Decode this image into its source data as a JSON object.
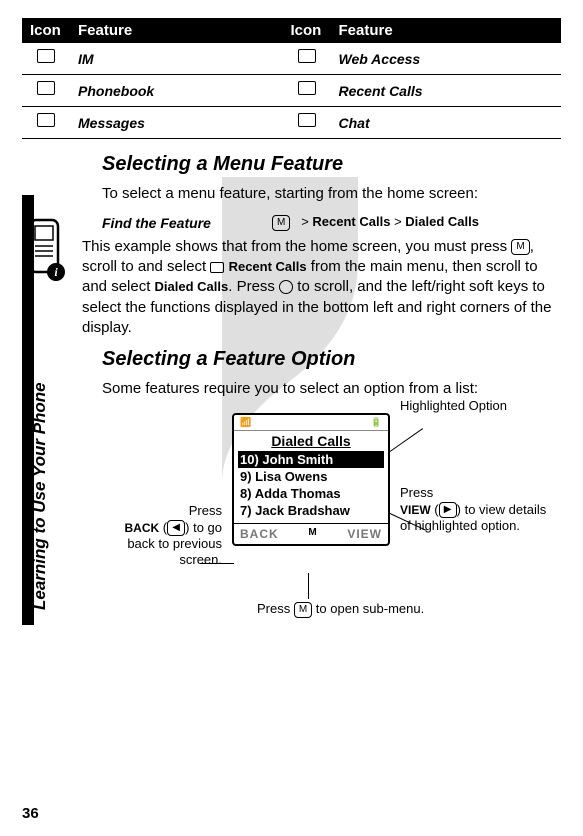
{
  "table": {
    "headers": [
      "Icon",
      "Feature",
      "Icon",
      "Feature"
    ],
    "rows": [
      {
        "a_label": "IM",
        "b_label": "Web Access"
      },
      {
        "a_label": "Phonebook",
        "b_label": "Recent Calls"
      },
      {
        "a_label": "Messages",
        "b_label": "Chat"
      }
    ]
  },
  "section1": {
    "heading": "Selecting a Menu Feature",
    "intro": "To select a menu feature, starting from the home screen:",
    "find_label": "Find the Feature",
    "path_sep": ">",
    "path_a": "Recent Calls",
    "path_b": "Dialed Calls",
    "menu_key": "M",
    "body_pre": "This example shows that from the home screen, you must press ",
    "body_mid1": ", scroll to and select ",
    "recent_calls_inline": "Recent Calls",
    "body_mid2": " from the main menu, then scroll to and select ",
    "dialed_calls_inline": "Dialed Calls",
    "body_mid3": ". Press ",
    "body_tail": " to scroll, and the left/right soft keys to select the functions displayed in the bottom left and right corners of the display."
  },
  "section2": {
    "heading": "Selecting a Feature Option",
    "intro": "Some features require you to select an option from a list:"
  },
  "phone_screen": {
    "title": "Dialed Calls",
    "items": [
      {
        "text": "10) John Smith",
        "highlighted": true
      },
      {
        "text": "9)  Lisa Owens",
        "highlighted": false
      },
      {
        "text": "8)  Adda Thomas",
        "highlighted": false
      },
      {
        "text": "7) Jack Bradshaw",
        "highlighted": false
      }
    ],
    "soft_left": "BACK",
    "soft_right": "VIEW",
    "soft_mid": "M"
  },
  "callouts": {
    "highlighted": "Highlighted Option",
    "view_pre": "Press ",
    "view_label": "VIEW",
    "view_post": " to view details of highlighted option.",
    "back_pre": "Press",
    "back_label": "BACK",
    "back_post": " to go back to previous screen.",
    "bottom_pre": "Press ",
    "bottom_post": " to open sub-menu."
  },
  "side_label": "Learning to Use Your Phone",
  "page_number": "36",
  "key_paren_open": "(",
  "key_paren_close": ")"
}
